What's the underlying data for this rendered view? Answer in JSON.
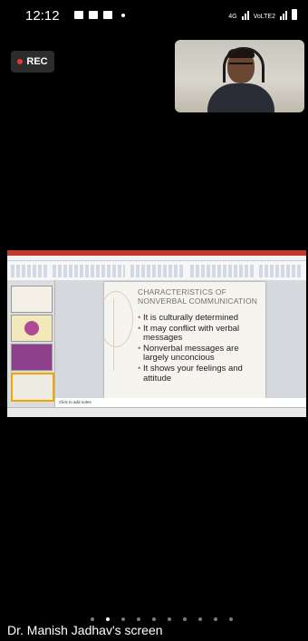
{
  "status_bar": {
    "time": "12:12",
    "network_labels": [
      "4G",
      "VoLTE2"
    ]
  },
  "meeting": {
    "rec_label": "REC",
    "screen_label": "Dr. Manish Jadhav's screen",
    "page_count": 10,
    "active_page": 1
  },
  "slide": {
    "title": "CHARACTERISTICS OF NONVERBAL COMMUNICATION",
    "bullets": [
      "It is culturally determined",
      "It may conflict with verbal messages",
      "Nonverbal messages are largely unconcious",
      "It shows your feelings and attitude"
    ],
    "notes_placeholder": "Click to add notes"
  },
  "colors": {
    "rec_dot": "#e53935",
    "ppt_accent": "#c0392b"
  }
}
